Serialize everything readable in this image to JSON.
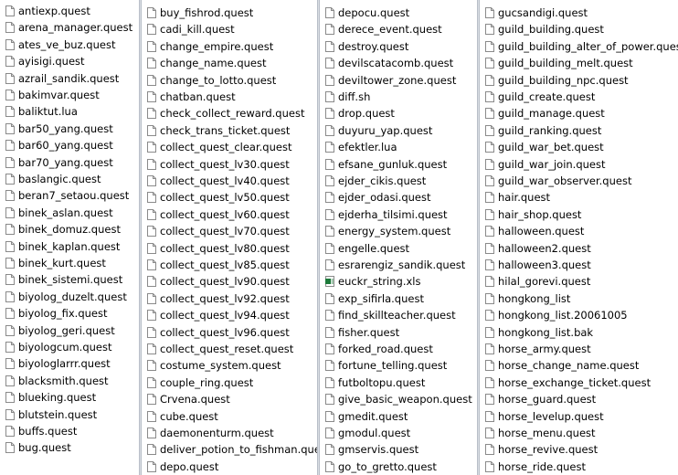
{
  "columns": [
    {
      "files": [
        {
          "name": "antiexp.quest",
          "type": "file"
        },
        {
          "name": "arena_manager.quest",
          "type": "file"
        },
        {
          "name": "ates_ve_buz.quest",
          "type": "file"
        },
        {
          "name": "ayisigi.quest",
          "type": "file"
        },
        {
          "name": "azrail_sandik.quest",
          "type": "file"
        },
        {
          "name": "bakimvar.quest",
          "type": "file"
        },
        {
          "name": "baliktut.lua",
          "type": "file"
        },
        {
          "name": "bar50_yang.quest",
          "type": "file"
        },
        {
          "name": "bar60_yang.quest",
          "type": "file"
        },
        {
          "name": "bar70_yang.quest",
          "type": "file"
        },
        {
          "name": "baslangic.quest",
          "type": "file"
        },
        {
          "name": "beran7_setaou.quest",
          "type": "file"
        },
        {
          "name": "binek_aslan.quest",
          "type": "file"
        },
        {
          "name": "binek_domuz.quest",
          "type": "file"
        },
        {
          "name": "binek_kaplan.quest",
          "type": "file"
        },
        {
          "name": "binek_kurt.quest",
          "type": "file"
        },
        {
          "name": "binek_sistemi.quest",
          "type": "file"
        },
        {
          "name": "biyolog_duzelt.quest",
          "type": "file"
        },
        {
          "name": "biyolog_fix.quest",
          "type": "file"
        },
        {
          "name": "biyolog_geri.quest",
          "type": "file"
        },
        {
          "name": "biyologcum.quest",
          "type": "file"
        },
        {
          "name": "biyologlarrr.quest",
          "type": "file"
        },
        {
          "name": "blacksmith.quest",
          "type": "file"
        },
        {
          "name": "blueking.quest",
          "type": "file"
        },
        {
          "name": "blutstein.quest",
          "type": "file"
        },
        {
          "name": "buffs.quest",
          "type": "file"
        },
        {
          "name": "bug.quest",
          "type": "file"
        }
      ]
    },
    {
      "files": [
        {
          "name": "buy_fishrod.quest",
          "type": "file"
        },
        {
          "name": "cadi_kill.quest",
          "type": "file"
        },
        {
          "name": "change_empire.quest",
          "type": "file"
        },
        {
          "name": "change_name.quest",
          "type": "file"
        },
        {
          "name": "change_to_lotto.quest",
          "type": "file"
        },
        {
          "name": "chatban.quest",
          "type": "file"
        },
        {
          "name": "check_collect_reward.quest",
          "type": "file"
        },
        {
          "name": "check_trans_ticket.quest",
          "type": "file"
        },
        {
          "name": "collect_quest_clear.quest",
          "type": "file"
        },
        {
          "name": "collect_quest_lv30.quest",
          "type": "file"
        },
        {
          "name": "collect_quest_lv40.quest",
          "type": "file"
        },
        {
          "name": "collect_quest_lv50.quest",
          "type": "file"
        },
        {
          "name": "collect_quest_lv60.quest",
          "type": "file"
        },
        {
          "name": "collect_quest_lv70.quest",
          "type": "file"
        },
        {
          "name": "collect_quest_lv80.quest",
          "type": "file"
        },
        {
          "name": "collect_quest_lv85.quest",
          "type": "file"
        },
        {
          "name": "collect_quest_lv90.quest",
          "type": "file"
        },
        {
          "name": "collect_quest_lv92.quest",
          "type": "file"
        },
        {
          "name": "collect_quest_lv94.quest",
          "type": "file"
        },
        {
          "name": "collect_quest_lv96.quest",
          "type": "file"
        },
        {
          "name": "collect_quest_reset.quest",
          "type": "file"
        },
        {
          "name": "costume_system.quest",
          "type": "file"
        },
        {
          "name": "couple_ring.quest",
          "type": "file"
        },
        {
          "name": "Crvena.quest",
          "type": "file"
        },
        {
          "name": "cube.quest",
          "type": "file"
        },
        {
          "name": "daemonenturm.quest",
          "type": "file"
        },
        {
          "name": "deliver_potion_to_fishman.quest",
          "type": "file"
        },
        {
          "name": "depo.quest",
          "type": "file"
        }
      ]
    },
    {
      "files": [
        {
          "name": "depocu.quest",
          "type": "file"
        },
        {
          "name": "derece_event.quest",
          "type": "file"
        },
        {
          "name": "destroy.quest",
          "type": "file"
        },
        {
          "name": "devilscatacomb.quest",
          "type": "file"
        },
        {
          "name": "deviltower_zone.quest",
          "type": "file"
        },
        {
          "name": "diff.sh",
          "type": "file"
        },
        {
          "name": "drop.quest",
          "type": "file"
        },
        {
          "name": "duyuru_yap.quest",
          "type": "file"
        },
        {
          "name": "efektler.lua",
          "type": "file"
        },
        {
          "name": "efsane_gunluk.quest",
          "type": "file"
        },
        {
          "name": "ejder_cikis.quest",
          "type": "file"
        },
        {
          "name": "ejder_odasi.quest",
          "type": "file"
        },
        {
          "name": "ejderha_tilsimi.quest",
          "type": "file"
        },
        {
          "name": "energy_system.quest",
          "type": "file"
        },
        {
          "name": "engelle.quest",
          "type": "file"
        },
        {
          "name": "esrarengiz_sandik.quest",
          "type": "file"
        },
        {
          "name": "euckr_string.xls",
          "type": "excel"
        },
        {
          "name": "exp_sifirla.quest",
          "type": "file"
        },
        {
          "name": "find_skillteacher.quest",
          "type": "file"
        },
        {
          "name": "fisher.quest",
          "type": "file"
        },
        {
          "name": "forked_road.quest",
          "type": "file"
        },
        {
          "name": "fortune_telling.quest",
          "type": "file"
        },
        {
          "name": "futboltopu.quest",
          "type": "file"
        },
        {
          "name": "give_basic_weapon.quest",
          "type": "file"
        },
        {
          "name": "gmedit.quest",
          "type": "file"
        },
        {
          "name": "gmodul.quest",
          "type": "file"
        },
        {
          "name": "gmservis.quest",
          "type": "file"
        },
        {
          "name": "go_to_gretto.quest",
          "type": "file"
        }
      ]
    },
    {
      "files": [
        {
          "name": "gucsandigi.quest",
          "type": "file"
        },
        {
          "name": "guild_building.quest",
          "type": "file"
        },
        {
          "name": "guild_building_alter_of_power.quest",
          "type": "file"
        },
        {
          "name": "guild_building_melt.quest",
          "type": "file"
        },
        {
          "name": "guild_building_npc.quest",
          "type": "file"
        },
        {
          "name": "guild_create.quest",
          "type": "file"
        },
        {
          "name": "guild_manage.quest",
          "type": "file"
        },
        {
          "name": "guild_ranking.quest",
          "type": "file"
        },
        {
          "name": "guild_war_bet.quest",
          "type": "file"
        },
        {
          "name": "guild_war_join.quest",
          "type": "file"
        },
        {
          "name": "guild_war_observer.quest",
          "type": "file"
        },
        {
          "name": "hair.quest",
          "type": "file"
        },
        {
          "name": "hair_shop.quest",
          "type": "file"
        },
        {
          "name": "halloween.quest",
          "type": "file"
        },
        {
          "name": "halloween2.quest",
          "type": "file"
        },
        {
          "name": "halloween3.quest",
          "type": "file"
        },
        {
          "name": "hilal_gorevi.quest",
          "type": "file"
        },
        {
          "name": "hongkong_list",
          "type": "file"
        },
        {
          "name": "hongkong_list.20061005",
          "type": "file"
        },
        {
          "name": "hongkong_list.bak",
          "type": "file"
        },
        {
          "name": "horse_army.quest",
          "type": "file"
        },
        {
          "name": "horse_change_name.quest",
          "type": "file"
        },
        {
          "name": "horse_exchange_ticket.quest",
          "type": "file"
        },
        {
          "name": "horse_guard.quest",
          "type": "file"
        },
        {
          "name": "horse_levelup.quest",
          "type": "file"
        },
        {
          "name": "horse_menu.quest",
          "type": "file"
        },
        {
          "name": "horse_revive.quest",
          "type": "file"
        },
        {
          "name": "horse_ride.quest",
          "type": "file"
        }
      ]
    }
  ],
  "colors": {
    "background": "#ffffff",
    "separator": "#d9dde3",
    "icon_border": "#8a8a8a",
    "excel_green": "#1d7a3a"
  }
}
